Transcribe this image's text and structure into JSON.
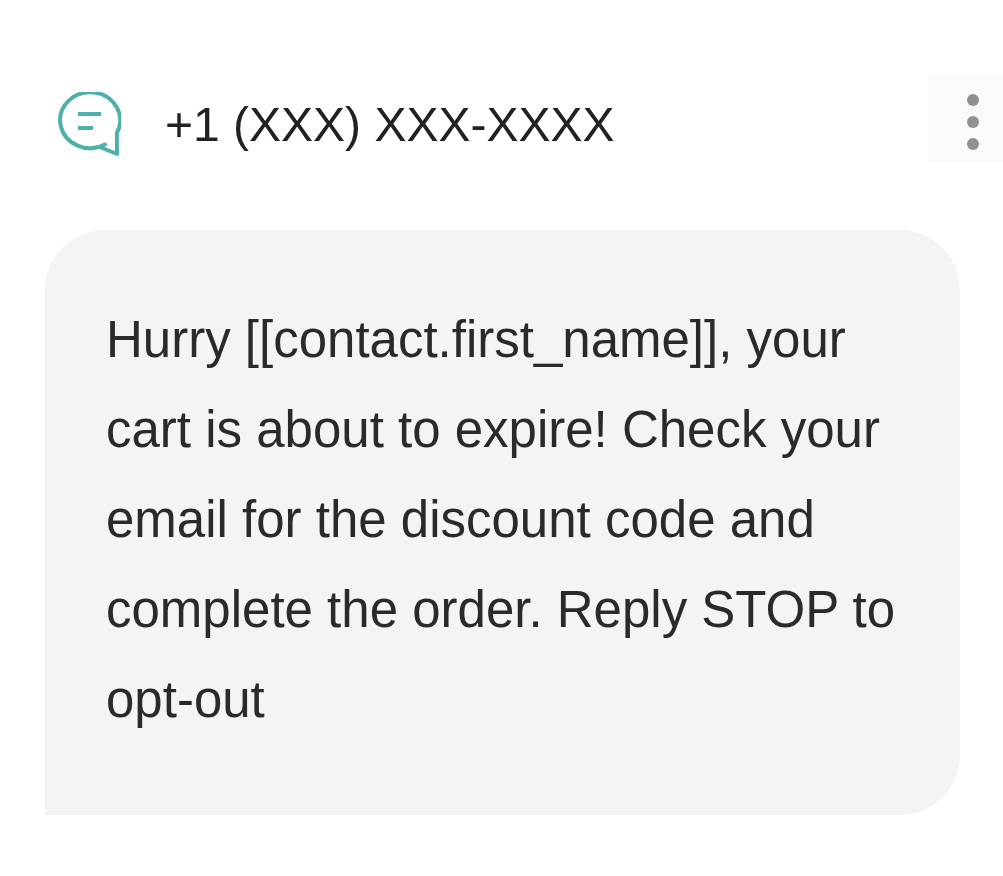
{
  "header": {
    "phone": "+1 (XXX) XXX-XXXX"
  },
  "message": {
    "text": "Hurry [[contact.first_name]], your cart is about to expire! Check your email for the discount code and complete the order. Reply STOP to opt-out"
  }
}
